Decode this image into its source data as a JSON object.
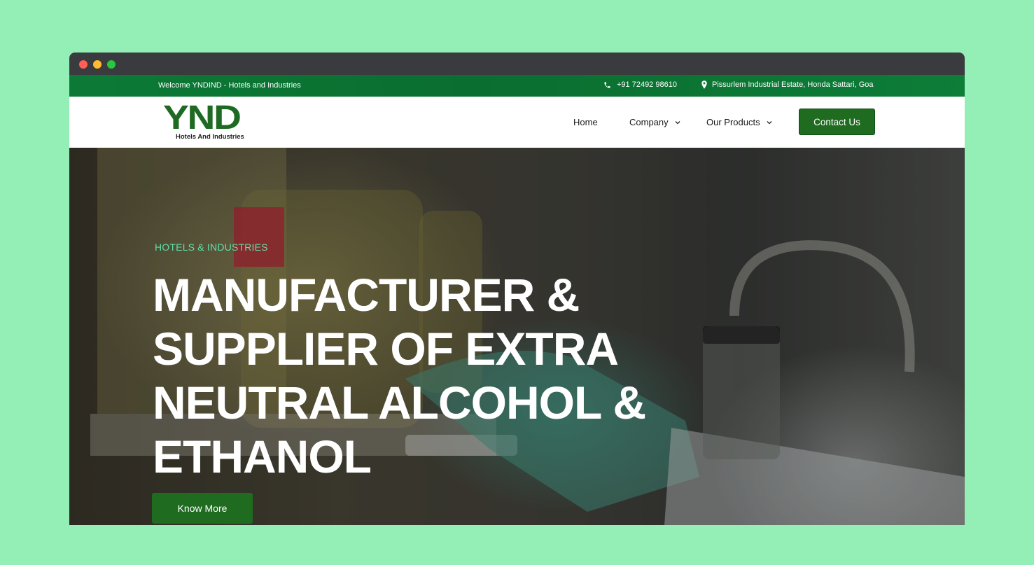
{
  "topbar": {
    "welcome": "Welcome YNDIND - Hotels and Industries",
    "phone": "+91 72492 98610",
    "address": "Pissurlem Industrial Estate, Honda Sattari, Goa"
  },
  "logo": {
    "wordmark": "YND",
    "tagline": "Hotels And Industries"
  },
  "nav": {
    "home": "Home",
    "company": "Company",
    "products": "Our Products",
    "contact": "Contact Us"
  },
  "hero": {
    "eyebrow": "HOTELS & INDUSTRIES",
    "headline": "MANUFACTURER & SUPPLIER OF EXTRA NEUTRAL ALCOHOL & ETHANOL",
    "cta": "Know More"
  },
  "icons": {
    "phone": "phone-icon",
    "location": "location-pin-icon",
    "dropdown": "chevron-down-icon"
  },
  "colors": {
    "page_background": "#93efb6",
    "topbar": "#0c7a36",
    "brand_green": "#1f6b20",
    "eyebrow": "#5fe0a9"
  }
}
